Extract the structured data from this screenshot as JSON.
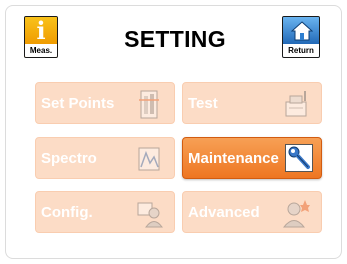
{
  "header": {
    "title": "SETTING",
    "meas_label": "Meas.",
    "return_label": "Return",
    "meas_icon": "info-i-icon",
    "return_icon": "home-icon"
  },
  "menu": {
    "set_points": {
      "label": "Set Points",
      "icon": "tower-levels-icon",
      "enabled": false
    },
    "test": {
      "label": "Test",
      "icon": "printer-tool-icon",
      "enabled": false
    },
    "spectro": {
      "label": "Spectro",
      "icon": "spectrum-chart-icon",
      "enabled": false
    },
    "maintenance": {
      "label": "Maintenance",
      "icon": "wrench-icon",
      "enabled": true
    },
    "config": {
      "label": "Config.",
      "icon": "user-config-icon",
      "enabled": false
    },
    "advanced": {
      "label": "Advanced",
      "icon": "user-star-icon",
      "enabled": false
    }
  },
  "colors": {
    "active_tile": "#ee7622",
    "inactive_tile": "#fcdcc6",
    "meas_button": "#f6a800",
    "return_button": "#2f7fd0"
  }
}
